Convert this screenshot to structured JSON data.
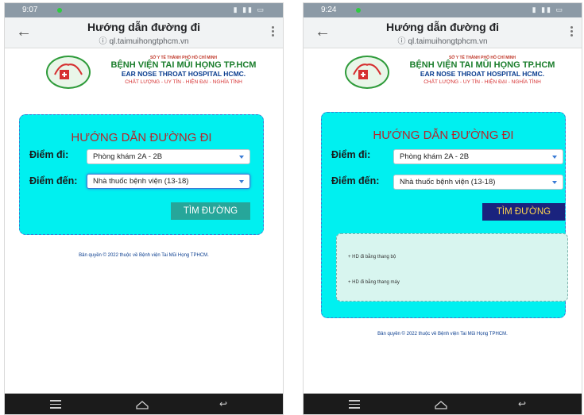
{
  "screens": [
    {
      "status_time": "9:07",
      "app_bar": {
        "title": "Hướng dẫn đường đi",
        "url": "ql.taimuihongtphcm.vn"
      },
      "header": {
        "small": "SỞ Y TẾ THÀNH PHỐ HỒ CHÍ MINH",
        "name": "BỆNH VIỆN TAI MŨI HỌNG TP.HCM",
        "english": "EAR NOSE THROAT HOSPITAL HCMC.",
        "slogan": "CHẤT LƯỢNG - UY TÍN - HIỆN ĐẠI - NGHĨA TÌNH"
      },
      "form": {
        "title": "HƯỚNG DẪN ĐƯỜNG ĐI",
        "from_label": "Điểm đi:",
        "from_value": "Phòng khám 2A - 2B",
        "to_label": "Điểm đến:",
        "to_value": "Nhà thuốc bệnh viện (13-18)",
        "button_label": "TÌM ĐƯỜNG"
      },
      "copyright": "Bản quyền © 2022 thuộc về Bệnh viện Tai Mũi Họng TPHCM."
    },
    {
      "status_time": "9:24",
      "app_bar": {
        "title": "Hướng dẫn đường đi",
        "url": "ql.taimuihongtphcm.vn"
      },
      "header": {
        "small": "SỞ Y TẾ THÀNH PHỐ HỒ CHÍ MINH",
        "name": "BỆNH VIỆN TAI MŨI HỌNG TP.HCM",
        "english": "EAR NOSE THROAT HOSPITAL HCMC.",
        "slogan": "CHẤT LƯỢNG - UY TÍN - HIỆN ĐẠI - NGHĨA TÌNH"
      },
      "form": {
        "title": "HƯỚNG DẪN ĐƯỜNG ĐI",
        "from_label": "Điểm đi:",
        "from_value": "Phòng khám 2A - 2B",
        "to_label": "Điểm đến:",
        "to_value": "Nhà thuốc bệnh viện (13-18)",
        "button_label": "TÌM ĐƯỜNG"
      },
      "directions": [
        "+ HD đi bằng thang bộ",
        "+ HD đi bằng thang máy"
      ],
      "copyright": "Bản quyền © 2022 thuộc về Bệnh viện Tai Mũi Họng TPHCM."
    }
  ],
  "colors": {
    "form_background": "#00f0f0",
    "title_red": "#b5262b",
    "button_green": "#26a69a",
    "button_navy": "#1a237e",
    "button_navy_text": "#ffd54f"
  }
}
